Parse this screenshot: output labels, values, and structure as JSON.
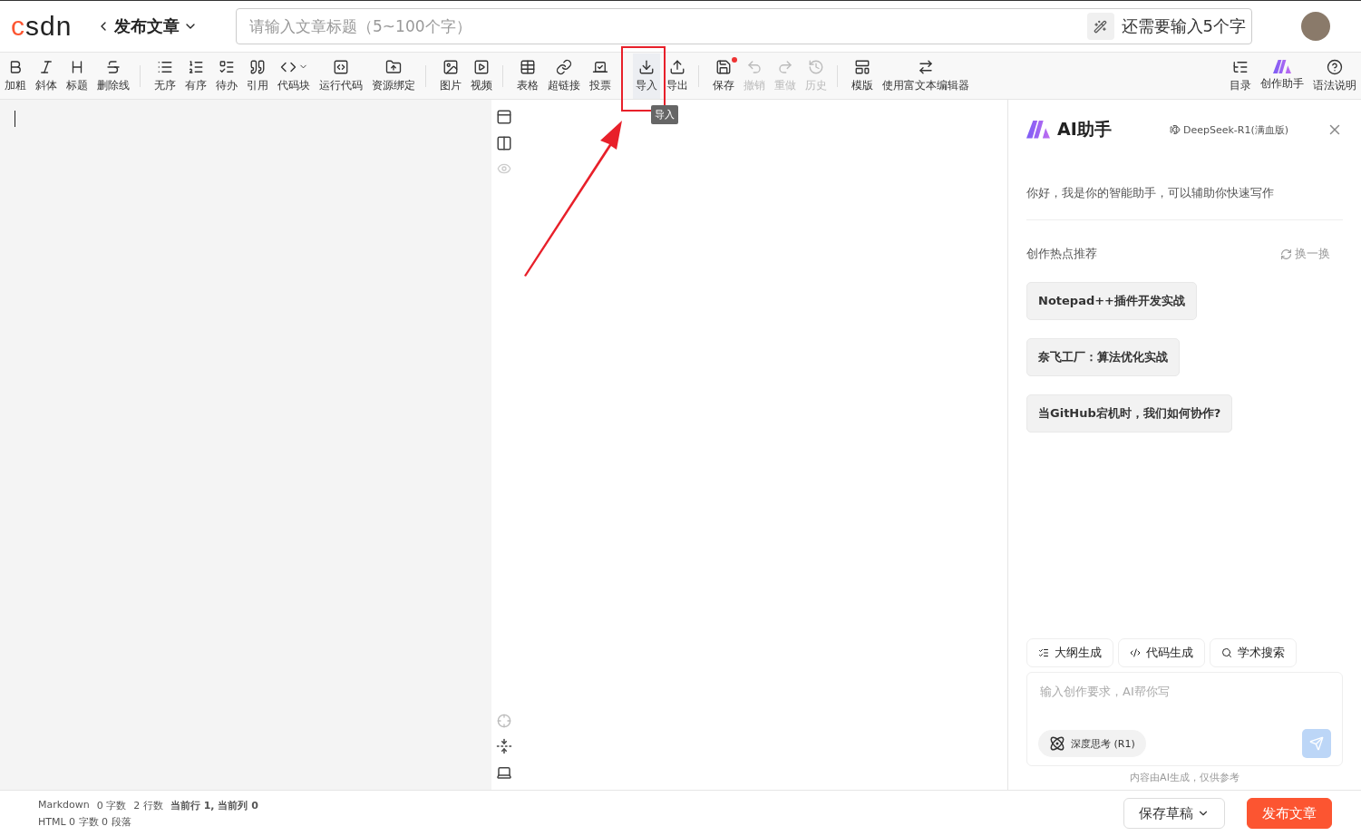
{
  "header": {
    "logo": "csdn",
    "back_title": "发布文章",
    "title_field": {
      "placeholder": "请输入文章标题（5~100个字）"
    },
    "hint": "还需要输入5个字"
  },
  "toolbar": {
    "groups": [
      [
        {
          "label": "加粗",
          "disabled": false,
          "dot": false
        },
        {
          "label": "斜体",
          "disabled": false,
          "dot": false
        },
        {
          "label": "标题",
          "disabled": false,
          "dot": false
        },
        {
          "label": "删除线",
          "disabled": false,
          "dot": false
        }
      ],
      [
        {
          "label": "无序",
          "disabled": false,
          "dot": false
        },
        {
          "label": "有序",
          "disabled": false,
          "dot": false
        },
        {
          "label": "待办",
          "disabled": false,
          "dot": false
        },
        {
          "label": "引用",
          "disabled": false,
          "dot": false
        },
        {
          "label": "代码块",
          "disabled": false,
          "dot": false
        },
        {
          "label": "运行代码",
          "disabled": false,
          "dot": false
        },
        {
          "label": "资源绑定",
          "disabled": false,
          "dot": false
        }
      ],
      [
        {
          "label": "图片",
          "disabled": false,
          "dot": false
        },
        {
          "label": "视频",
          "disabled": false,
          "dot": false
        }
      ],
      [
        {
          "label": "表格",
          "disabled": false,
          "dot": false
        },
        {
          "label": "超链接",
          "disabled": false,
          "dot": false
        },
        {
          "label": "投票",
          "disabled": false,
          "dot": false
        }
      ],
      [
        {
          "label": "导入",
          "disabled": false,
          "dot": false,
          "highlighted": true
        },
        {
          "label": "导出",
          "disabled": false,
          "dot": false,
          "highlighted": false
        }
      ],
      [
        {
          "label": "保存",
          "disabled": false,
          "dot": true
        },
        {
          "label": "撤销",
          "disabled": true,
          "dot": false
        },
        {
          "label": "重做",
          "disabled": true,
          "dot": false
        },
        {
          "label": "历史",
          "disabled": true,
          "dot": false
        }
      ],
      [
        {
          "label": "模版",
          "disabled": false,
          "dot": false
        },
        {
          "label": "使用富文本编辑器",
          "disabled": false,
          "dot": false
        }
      ]
    ],
    "right": [
      {
        "label": "目录"
      },
      {
        "label": "创作助手"
      },
      {
        "label": "语法说明"
      }
    ],
    "tooltip": "导入"
  },
  "status": {
    "mode": "Markdown",
    "words": "0 字数",
    "lines": "2 行数",
    "position": "当前行 1, 当前列 0",
    "html": "HTML  0 字数  0 段落"
  },
  "ai_panel": {
    "title": "AI助手",
    "model": "DeepSeek-R1(满血版)",
    "greeting": "你好，我是你的智能助手，可以辅助你快速写作",
    "section": "创作热点推荐",
    "refresh": "换一换",
    "topics": [
      "Notepad++插件开发实战",
      "奈飞工厂：算法优化实战",
      "当GitHub宕机时，我们如何协作?"
    ],
    "actions": [
      "大纲生成",
      "代码生成",
      "学术搜索"
    ],
    "input": {
      "placeholder": "输入创作要求，AI帮你写"
    },
    "deep_think": {
      "label": "深度思考 (R1)",
      "on": false
    },
    "disclaimer": "内容由AI生成，仅供参考"
  },
  "footer": {
    "buttons": [
      "保存草稿",
      "发布文章"
    ]
  }
}
